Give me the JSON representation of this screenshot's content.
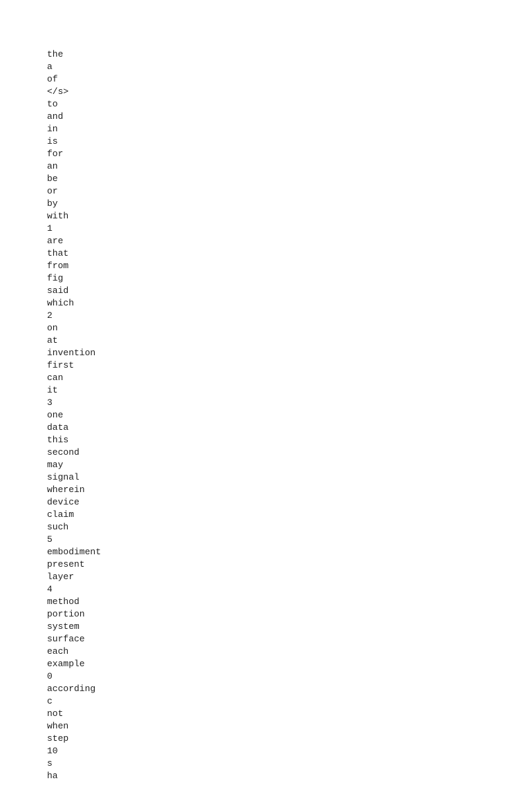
{
  "wordlist": {
    "words": [
      "the",
      "a",
      "of",
      "</s>",
      "to",
      "and",
      "in",
      "is",
      "for",
      "an",
      "be",
      "or",
      "by",
      "with",
      "1",
      "are",
      "that",
      "from",
      "fig",
      "said",
      "which",
      "2",
      "on",
      "at",
      "invention",
      "first",
      "can",
      "it",
      "3",
      "one",
      "data",
      "this",
      "second",
      "may",
      "signal",
      "wherein",
      "device",
      "claim",
      "such",
      "5",
      "embodiment",
      "present",
      "layer",
      "4",
      "method",
      "portion",
      "system",
      "surface",
      "each",
      "example",
      "0",
      "according",
      "c",
      "not",
      "when",
      "step",
      "10",
      "s",
      "ha"
    ]
  }
}
